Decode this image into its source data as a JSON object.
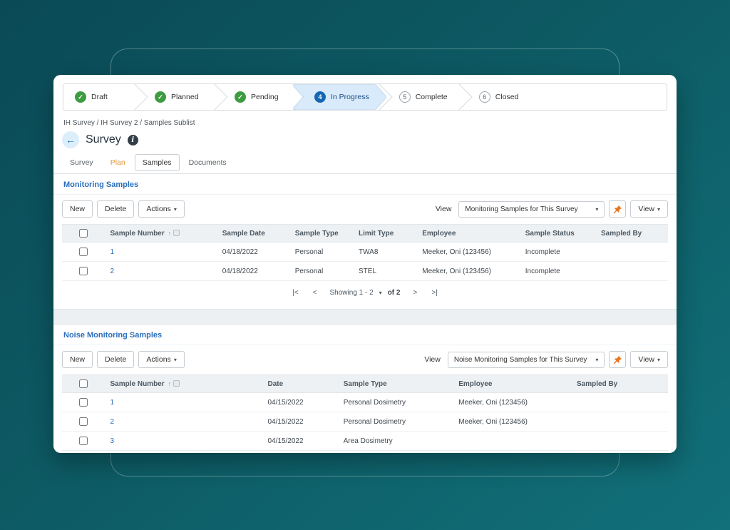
{
  "icons": {
    "check": "✓",
    "caret_down": "▾",
    "sort_asc": "↑",
    "back_arrow": "←",
    "info": "i",
    "pager_first": "|<",
    "pager_prev": "<",
    "pager_next": ">",
    "pager_last": ">|"
  },
  "colors": {
    "accent_blue": "#1467b3",
    "link_blue": "#2a6ebb",
    "done_green": "#3f9b41",
    "pin_orange": "#e87722",
    "tab_accent_orange": "#e2973c",
    "active_step_fill": "#d9eafb"
  },
  "stepper": {
    "steps": [
      {
        "label": "Draft",
        "state": "done"
      },
      {
        "label": "Planned",
        "state": "done"
      },
      {
        "label": "Pending",
        "state": "done"
      },
      {
        "label": "In Progress",
        "state": "active",
        "number": "4"
      },
      {
        "label": "Complete",
        "state": "todo",
        "number": "5"
      },
      {
        "label": "Closed",
        "state": "todo",
        "number": "6"
      }
    ]
  },
  "breadcrumb": "IH Survey / IH Survey 2 / Samples Sublist",
  "header": {
    "title": "Survey"
  },
  "tabs": [
    {
      "label": "Survey",
      "state": ""
    },
    {
      "label": "Plan",
      "state": "accent"
    },
    {
      "label": "Samples",
      "state": "active"
    },
    {
      "label": "Documents",
      "state": ""
    }
  ],
  "sections": [
    {
      "title": "Monitoring Samples",
      "toolbar": {
        "new_label": "New",
        "delete_label": "Delete",
        "actions_label": "Actions",
        "view_label": "View",
        "view_selected": "Monitoring Samples for This Survey",
        "view_menu_label": "View"
      },
      "table": {
        "columns": [
          "Sample Number",
          "Sample Date",
          "Sample Type",
          "Limit Type",
          "Employee",
          "Sample Status",
          "Sampled By"
        ],
        "rows": [
          [
            "1",
            "04/18/2022",
            "Personal",
            "TWA8",
            "Meeker, Oni (123456)",
            "Incomplete",
            ""
          ],
          [
            "2",
            "04/18/2022",
            "Personal",
            "STEL",
            "Meeker, Oni (123456)",
            "Incomplete",
            ""
          ]
        ]
      },
      "pagination": {
        "showing": "Showing 1 - 2",
        "of": "of 2"
      }
    },
    {
      "title": "Noise Monitoring Samples",
      "toolbar": {
        "new_label": "New",
        "delete_label": "Delete",
        "actions_label": "Actions",
        "view_label": "View",
        "view_selected": "Noise Monitoring Samples for This Survey",
        "view_menu_label": "View"
      },
      "table": {
        "columns": [
          "Sample Number",
          "Date",
          "Sample Type",
          "Employee",
          "Sampled By"
        ],
        "rows": [
          [
            "1",
            "04/15/2022",
            "Personal Dosimetry",
            "Meeker, Oni (123456)",
            ""
          ],
          [
            "2",
            "04/15/2022",
            "Personal Dosimetry",
            "Meeker, Oni (123456)",
            ""
          ],
          [
            "3",
            "04/15/2022",
            "Area Dosimetry",
            "",
            ""
          ]
        ]
      }
    }
  ]
}
